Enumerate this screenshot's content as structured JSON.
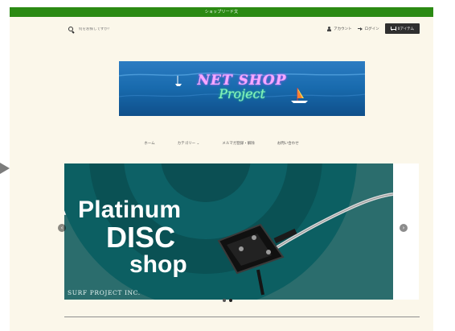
{
  "announcement": {
    "text": "ショップリード文"
  },
  "header": {
    "search": {
      "placeholder": "何をお探しですか？",
      "icon": "search-icon"
    },
    "account_label": "アカウント",
    "login_label": "ログイン",
    "cart_label": "0アイテム"
  },
  "logo": {
    "line1": "NET SHOP",
    "line2": "Project"
  },
  "nav": {
    "items": [
      {
        "label": "ホーム"
      },
      {
        "label": "カテゴリー ⌄"
      },
      {
        "label": "メルマガ登録・解除"
      },
      {
        "label": "お問い合わせ"
      }
    ]
  },
  "hero": {
    "line1": "Platinum",
    "line2": "DISC",
    "line3": "shop",
    "caption": "SURF PROJECT INC.",
    "prev_icon": "chevron-left-icon",
    "next_icon": "chevron-right-icon",
    "dots": 2
  },
  "colors": {
    "announcement_bg": "#2b8a13",
    "page_bg": "#fbf7ea",
    "cart_bg": "#2f2f2f"
  }
}
